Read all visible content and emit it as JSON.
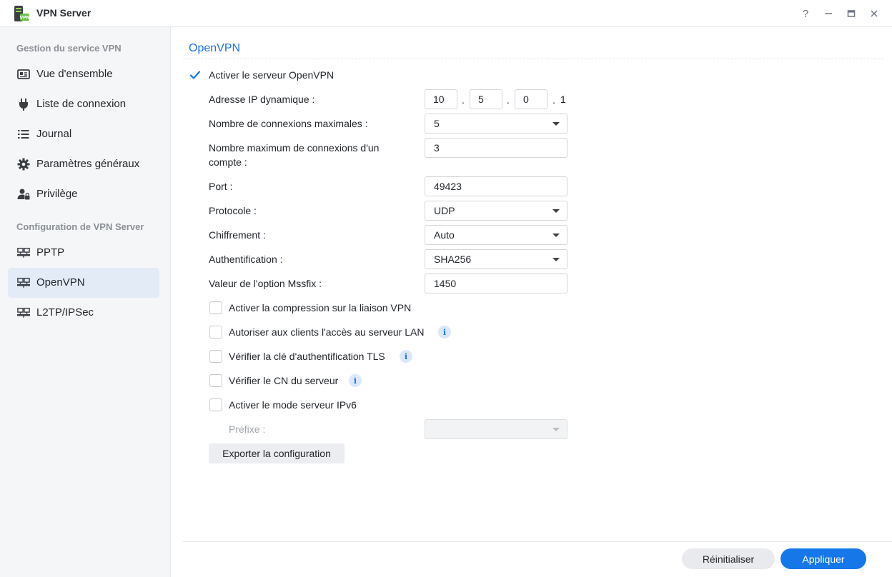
{
  "window": {
    "title": "VPN Server",
    "icon": "vpn-server-app-icon",
    "controls": [
      "?",
      "–",
      "□",
      "×"
    ]
  },
  "sidebar": {
    "sections": [
      "Gestion du service VPN",
      "Configuration de VPN Server"
    ],
    "items": [
      {
        "label": "Vue d'ensemble",
        "icon": "overview-icon"
      },
      {
        "label": "Liste de connexion",
        "icon": "plug-icon"
      },
      {
        "label": "Journal",
        "icon": "list-icon"
      },
      {
        "label": "Paramètres généraux",
        "icon": "gear-icon"
      },
      {
        "label": "Privilège",
        "icon": "user-lock-icon"
      },
      {
        "label": "PPTP",
        "icon": "network-icon"
      },
      {
        "label": "OpenVPN",
        "icon": "network-icon",
        "active": true
      },
      {
        "label": "L2TP/IPSec",
        "icon": "network-icon"
      }
    ]
  },
  "main": {
    "title": "OpenVPN",
    "enable_server": {
      "label": "Activer le serveur OpenVPN",
      "checked": true
    },
    "dynamic_ip": {
      "label": "Adresse IP dynamique :",
      "octets": [
        "10",
        "5",
        "0"
      ],
      "last": "1"
    },
    "max_connections": {
      "label": "Nombre de connexions maximales :",
      "value": "5"
    },
    "max_per_account": {
      "label": "Nombre maximum de connexions d'un compte :",
      "value": "3"
    },
    "port": {
      "label": "Port :",
      "value": "49423"
    },
    "protocol": {
      "label": "Protocole :",
      "value": "UDP"
    },
    "encryption": {
      "label": "Chiffrement :",
      "value": "Auto"
    },
    "authentication": {
      "label": "Authentification :",
      "value": "SHA256"
    },
    "mssfix": {
      "label": "Valeur de l'option Mssfix :",
      "value": "1450"
    },
    "options": [
      {
        "label": "Activer la compression sur la liaison VPN",
        "checked": false,
        "info": false
      },
      {
        "label": "Autoriser aux clients l'accès au serveur LAN",
        "checked": false,
        "info": true
      },
      {
        "label": "Vérifier la clé d'authentification TLS",
        "checked": false,
        "info": true
      },
      {
        "label": "Vérifier le CN du serveur",
        "checked": false,
        "info": true
      },
      {
        "label": "Activer le mode serveur IPv6",
        "checked": false,
        "info": false
      }
    ],
    "prefix": {
      "label": "Préfixe :",
      "value": ""
    },
    "info_glyph": "i",
    "export_label": "Exporter la configuration"
  },
  "footer": {
    "reset_label": "Réinitialiser",
    "apply_label": "Appliquer"
  },
  "colors": {
    "accent": "#1677e8",
    "active_nav": "#e3ebf7"
  }
}
